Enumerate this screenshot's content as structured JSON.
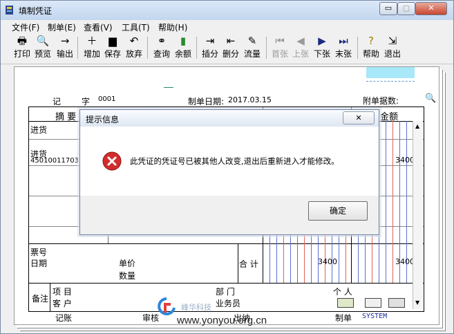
{
  "window": {
    "title": "填制凭证",
    "min_glyph": "▭",
    "max_glyph": "▢",
    "close_glyph": "✕"
  },
  "menu": [
    "文件(F)",
    "制单(E)",
    "查看(V)",
    "工具(T)",
    "帮助(H)"
  ],
  "toolbar": {
    "print": "打印",
    "preview": "预览",
    "export": "输出",
    "add": "增加",
    "save": "保存",
    "abandon": "放弃",
    "query": "查询",
    "balance": "余额",
    "insert_row": "插分",
    "delete_row": "删分",
    "flow": "流量",
    "first": "首张",
    "prev": "上张",
    "next": "下张",
    "last": "末张",
    "help": "帮助",
    "exit": "退出"
  },
  "voucher": {
    "type_label": "记",
    "zi_label": "字",
    "number": "0001",
    "date_label": "制单日期:",
    "date": "2017.03.15",
    "attach_label": "附单据数:",
    "col_summary": "摘 要",
    "col_amount": "金额",
    "row1_summary": "进货",
    "row2_summary": "进货",
    "row2_code": "450100117031",
    "row2_amount": "3400",
    "bill_no_label": "票号",
    "date_row_label": "日期",
    "unit_price_label": "单价",
    "quantity_label": "数量",
    "total_label": "合 计",
    "total_debit": "3400",
    "total_credit": "3400",
    "remark_label": "备注",
    "project_label": "项 目",
    "customer_label": "客 户",
    "dept_label": "部 门",
    "salesman_label": "业务员",
    "person_label": "个 人",
    "bookkeeping_label": "记账",
    "audit_label": "审核",
    "cashier_label": "出纳",
    "maker_label": "制单",
    "maker": "SYSTEM"
  },
  "dialog": {
    "title": "提示信息",
    "close_glyph": "✕",
    "message": "此凭证的凭证号已被其他人改变,退出后重新进入才能修改。",
    "ok": "确定"
  },
  "watermark": {
    "url": "www.yonyou.org.cn",
    "brand": "峰华科技"
  },
  "colors": {
    "accent": "#5d6fd0",
    "error": "#d12d2d",
    "guide_red": "#e06060",
    "cyan": "#a8e8f8"
  }
}
